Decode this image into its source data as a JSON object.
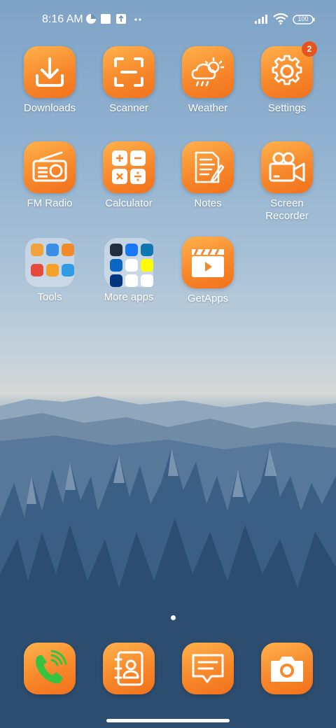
{
  "status_bar": {
    "time": "8:16 AM",
    "battery": "100",
    "icons": [
      "data-saver-icon",
      "notification-square-icon",
      "upload-box-icon",
      "more-dots-icon",
      "signal-icon",
      "wifi-icon",
      "battery-icon"
    ]
  },
  "apps": [
    {
      "label": "Downloads",
      "icon": "download-icon"
    },
    {
      "label": "Scanner",
      "icon": "scanner-icon"
    },
    {
      "label": "Weather",
      "icon": "weather-icon"
    },
    {
      "label": "Settings",
      "icon": "gear-icon",
      "badge": "2"
    },
    {
      "label": "FM Radio",
      "icon": "radio-icon"
    },
    {
      "label": "Calculator",
      "icon": "calculator-icon"
    },
    {
      "label": "Notes",
      "icon": "notes-icon"
    },
    {
      "label": "Screen Recorder",
      "label_line1": "Screen",
      "label_line2": "Recorder",
      "icon": "video-camera-icon"
    },
    {
      "label": "Tools",
      "icon": "folder-icon"
    },
    {
      "label": "More apps",
      "icon": "folder-icon"
    },
    {
      "label": "GetApps",
      "icon": "clapperboard-icon"
    }
  ],
  "dock": [
    {
      "name": "Phone",
      "icon": "phone-icon"
    },
    {
      "name": "Contacts",
      "icon": "contacts-icon"
    },
    {
      "name": "Messages",
      "icon": "message-icon"
    },
    {
      "name": "Camera",
      "icon": "camera-icon"
    }
  ],
  "colors": {
    "accent": "#f7882b",
    "badge": "#e8531f",
    "phone_green": "#35c43f"
  }
}
